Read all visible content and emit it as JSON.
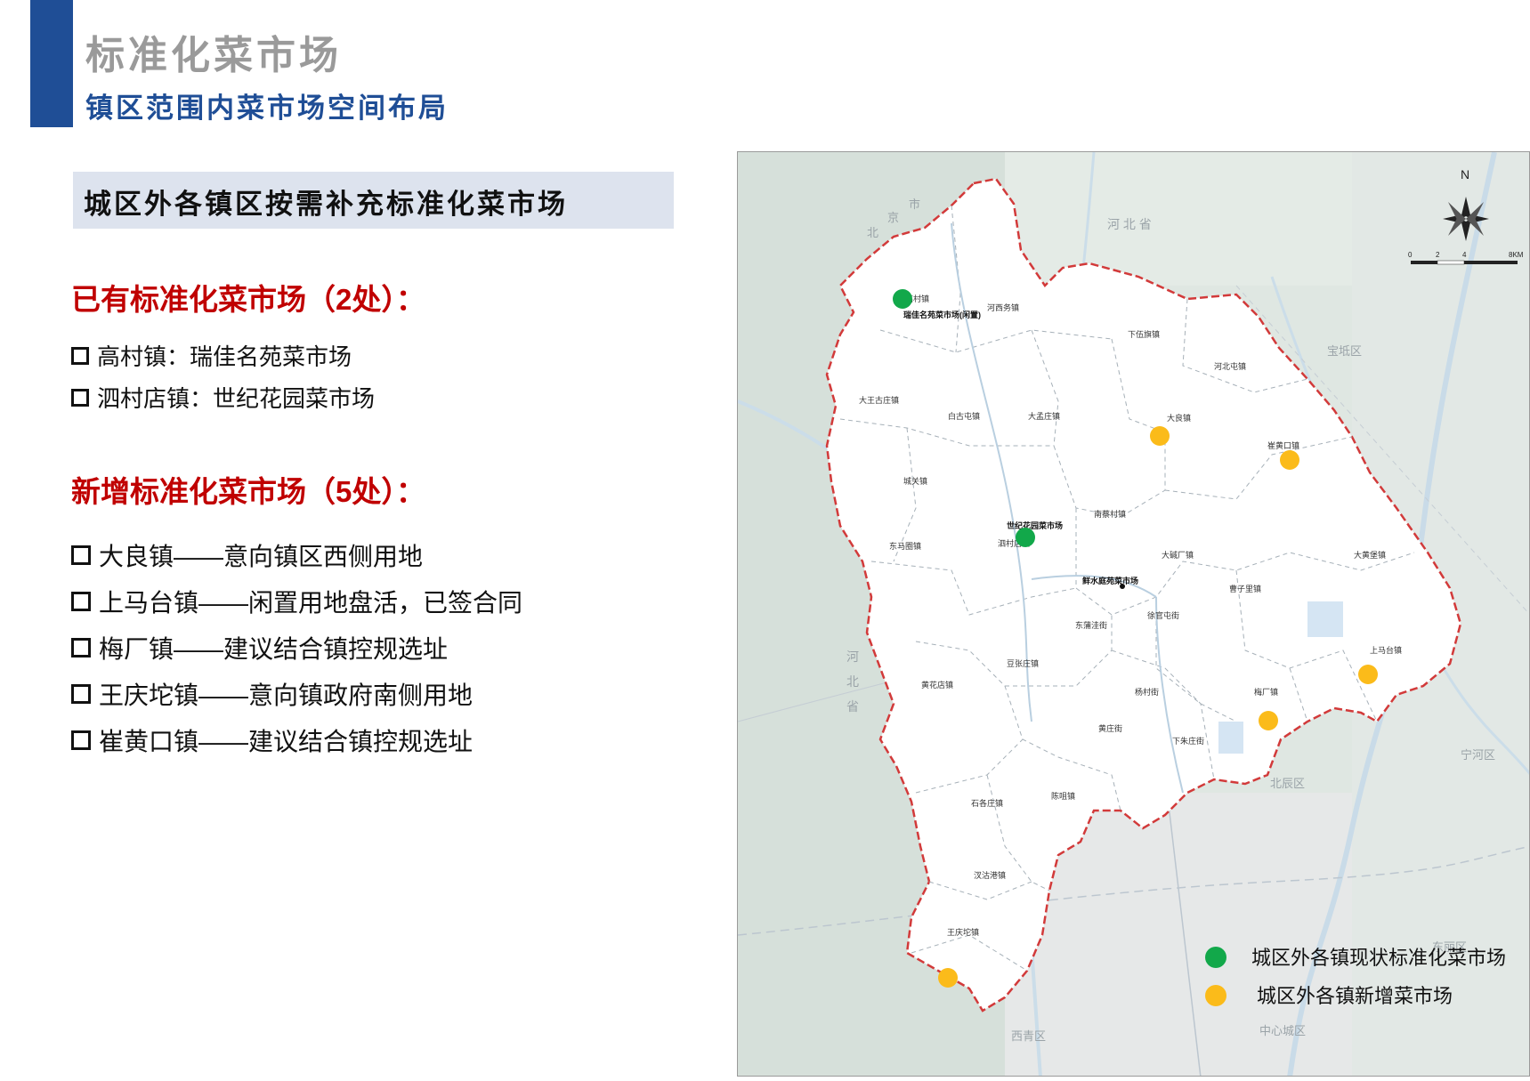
{
  "header": {
    "title": "标准化菜市场",
    "subtitle": "镇区范围内菜市场空间布局"
  },
  "section": {
    "title": "城区外各镇区按需补充标准化菜市场"
  },
  "existing": {
    "heading": "已有标准化菜市场（2处）：",
    "items": [
      "高村镇：瑞佳名苑菜市场",
      "泗村店镇：世纪花园菜市场"
    ]
  },
  "new": {
    "heading": "新增标准化菜市场（5处）：",
    "items": [
      "大良镇——意向镇区西侧用地",
      "上马台镇——闲置用地盘活，已签合同",
      "梅厂镇——建议结合镇控规选址",
      "王庆坨镇——意向镇政府南侧用地",
      "崔黄口镇——建议结合镇控规选址"
    ]
  },
  "map": {
    "compass_label": "N",
    "scale": {
      "labels": [
        "0",
        "2",
        "4",
        "8KM"
      ]
    },
    "colors": {
      "existing": "#12a84a",
      "new": "#fbbb1a",
      "boundary": "#d23a3a"
    },
    "region_labels": {
      "beijing_city_1": "北",
      "beijing_city_2": "京",
      "beijing_city_3": "市",
      "hebei": "河 北 省",
      "baodi": "宝坻区",
      "beichen": "北辰区",
      "dongli": "东丽区",
      "xiqing": "西青区",
      "central": "中心城区",
      "ninghe": "宁河区",
      "hebei_west_1": "河",
      "hebei_west_2": "北",
      "hebei_west_3": "省"
    },
    "towns": [
      "高村镇",
      "河西务镇",
      "下伍旗镇",
      "河北屯镇",
      "大王古庄镇",
      "白古屯镇",
      "大孟庄镇",
      "大良镇",
      "崔黄口镇",
      "城关镇",
      "南蔡村镇",
      "东马圈镇",
      "泗村店镇",
      "大碱厂镇",
      "大黄堡镇",
      "曹子里镇",
      "徐官屯街",
      "东蒲洼街",
      "上马台镇",
      "豆张庄镇",
      "黄花店镇",
      "杨村街",
      "梅厂镇",
      "黄庄街",
      "下朱庄街",
      "石各庄镇",
      "陈咀镇",
      "汊沽港镇",
      "王庆坨镇"
    ],
    "market_labels": {
      "ruijia": "瑞佳名苑菜市场(闲置)",
      "shiji": "世纪花园菜市场",
      "xianshui": "鲜水庭苑菜市场"
    },
    "existing_markets": [
      {
        "name": "瑞佳名苑菜市场"
      },
      {
        "name": "世纪花园菜市场"
      }
    ],
    "new_markets": [
      {
        "town": "大良镇"
      },
      {
        "town": "崔黄口镇"
      },
      {
        "town": "上马台镇"
      },
      {
        "town": "梅厂镇"
      },
      {
        "town": "王庆坨镇"
      }
    ]
  },
  "legend": {
    "existing_label": "城区外各镇现状标准化菜市场",
    "new_label": "城区外各镇新增菜市场"
  }
}
